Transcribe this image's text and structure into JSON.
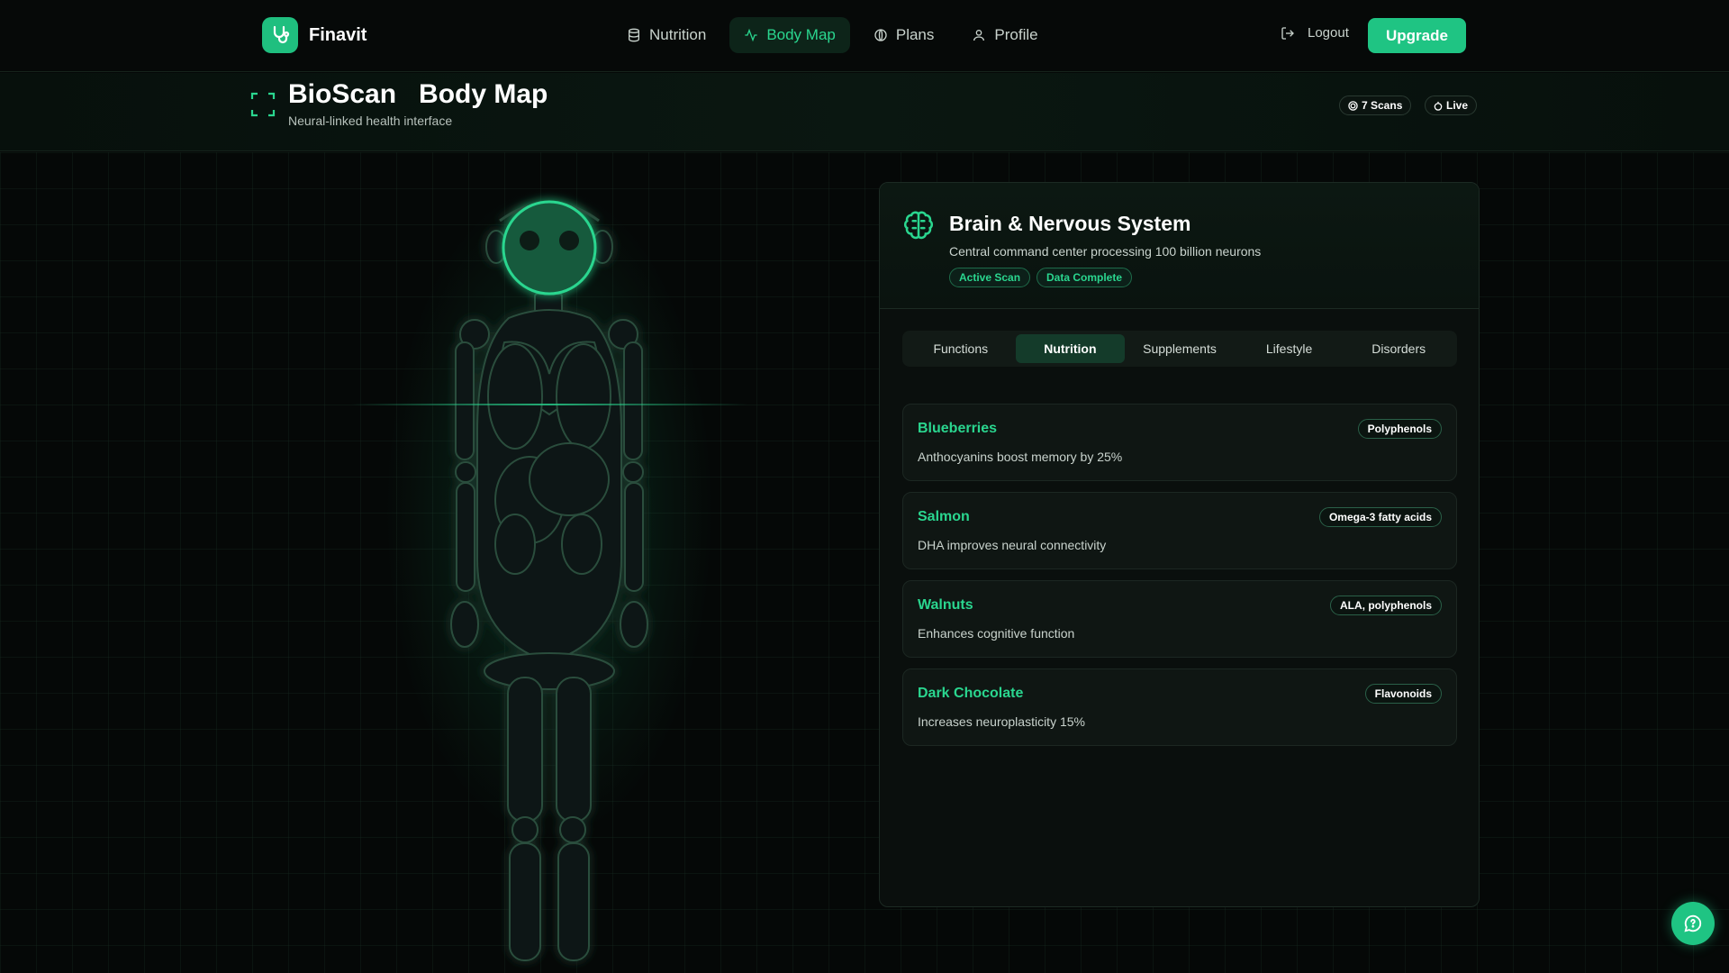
{
  "brand": {
    "name": "Finavit"
  },
  "nav": {
    "items": [
      {
        "label": "Nutrition",
        "icon": "database-icon"
      },
      {
        "label": "Body Map",
        "icon": "activity-icon"
      },
      {
        "label": "Plans",
        "icon": "globe-icon"
      },
      {
        "label": "Profile",
        "icon": "user-icon"
      }
    ],
    "active": "Body Map",
    "logout_label": "Logout",
    "upgrade_label": "Upgrade"
  },
  "header": {
    "title_left": "BioScan",
    "title_right": "Body Map",
    "subtitle": "Neural-linked health interface",
    "scans_label": "7 Scans",
    "live_label": "Live"
  },
  "panel": {
    "title": "Brain & Nervous System",
    "description": "Central command center processing 100 billion neurons",
    "tags": [
      "Active Scan",
      "Data Complete"
    ],
    "tabs": [
      "Functions",
      "Nutrition",
      "Supplements",
      "Lifestyle",
      "Disorders"
    ],
    "active_tab": "Nutrition",
    "foods": [
      {
        "name": "Blueberries",
        "desc": "Anthocyanins boost memory by 25%",
        "badge": "Polyphenols"
      },
      {
        "name": "Salmon",
        "desc": "DHA improves neural connectivity",
        "badge": "Omega-3 fatty acids"
      },
      {
        "name": "Walnuts",
        "desc": "Enhances cognitive function",
        "badge": "ALA, polyphenols"
      },
      {
        "name": "Dark Chocolate",
        "desc": "Increases neuroplasticity 15%",
        "badge": "Flavonoids"
      }
    ]
  },
  "colors": {
    "accent": "#1fc483",
    "accent_text": "#2ad68f",
    "background": "#050807"
  }
}
